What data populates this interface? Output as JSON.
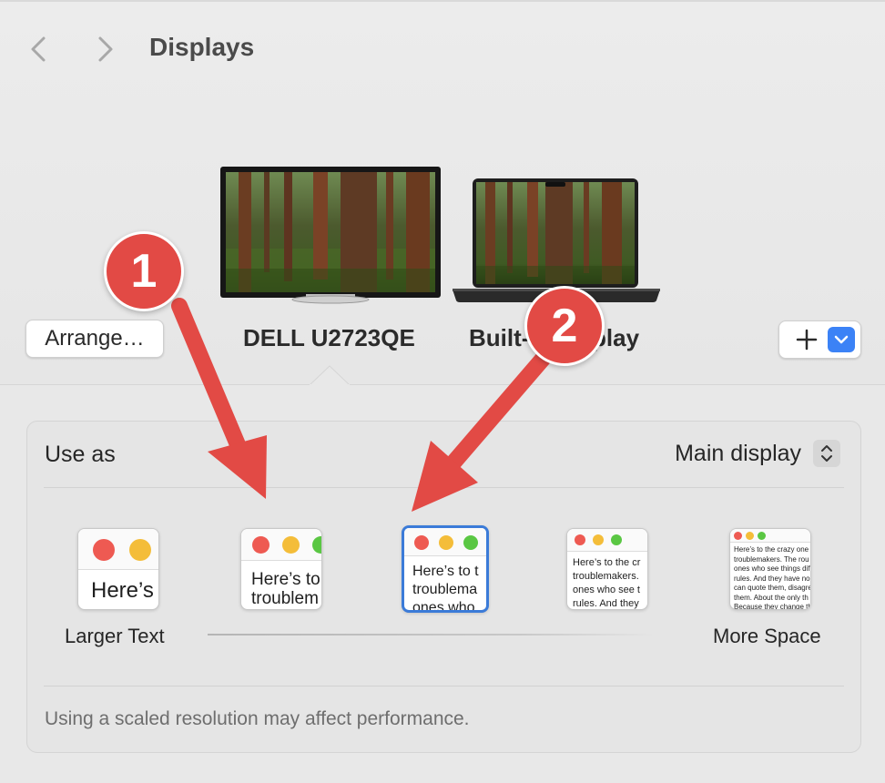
{
  "header": {
    "title": "Displays",
    "back_icon": "chevron-left-icon",
    "forward_icon": "chevron-right-icon"
  },
  "arrangement": {
    "arrange_label": "Arrange…",
    "displays": [
      {
        "name": "DELL U2723QE",
        "selected": true
      },
      {
        "name": "Built-in Display",
        "visible_left": "Built-",
        "visible_right": "play",
        "selected": false
      }
    ],
    "add_icon": "plus-icon",
    "menu_icon": "chevron-down-icon"
  },
  "settings": {
    "use_as_label": "Use as",
    "use_as_value": "Main display",
    "resolution": {
      "left_label": "Larger Text",
      "right_label": "More Space",
      "options": [
        {
          "text": "Here’s"
        },
        {
          "text": "Here’s to\ntroublem"
        },
        {
          "text": "Here’s to t\ntroublema\nones who"
        },
        {
          "text": "Here’s to the cr\ntroublemakers.\nones who see t\nrules. And they"
        },
        {
          "text": "Here’s to the crazy one\ntroublemakers. The rou\nones who see things dif\nrules. And they have no\ncan quote them, disagre\nthem. About the only th\nBecause they change th"
        }
      ],
      "selected_index": 2
    },
    "note": "Using a scaled resolution may affect performance."
  },
  "annotations": {
    "callouts": [
      "1",
      "2"
    ],
    "color": "#e24a45"
  },
  "colors": {
    "accent": "#3b82f6",
    "selection_border": "#3b7bd8",
    "traffic_red": "#ee5a52",
    "traffic_yellow": "#f4bd39",
    "traffic_green": "#5ac743"
  }
}
